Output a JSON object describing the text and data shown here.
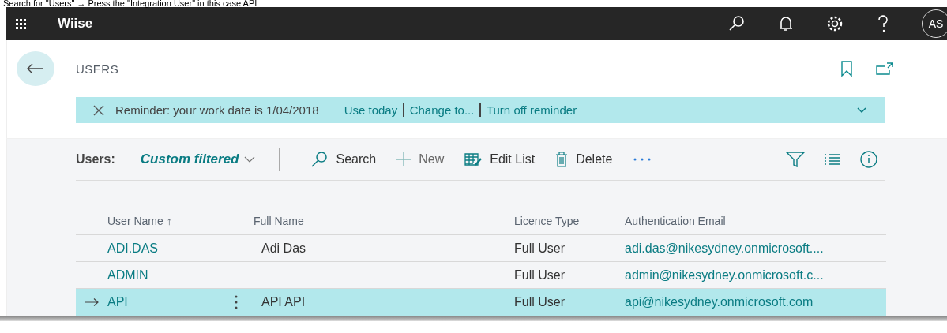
{
  "caption": "Search for \"Users\" → Press the \"Integration User\" in this case API",
  "topbar": {
    "app_name": "Wiise",
    "avatar": "AS"
  },
  "page": {
    "title": "USERS"
  },
  "reminder": {
    "message": "Reminder: your work date is 1/04/2018",
    "actions": [
      "Use today",
      "Change to...",
      "Turn off reminder"
    ]
  },
  "action_bar": {
    "view_label": "Users:",
    "filter": "Custom filtered",
    "actions": [
      "Search",
      "New",
      "Edit List",
      "Delete"
    ]
  },
  "table": {
    "columns": [
      "User Name ↑",
      "Full Name",
      "Licence Type",
      "Authentication Email"
    ],
    "rows": [
      {
        "user_name": "ADI.DAS",
        "full_name": "Adi Das",
        "licence_type": "Full User",
        "email": "adi.das@nikesydney.onmicrosoft....",
        "selected": false
      },
      {
        "user_name": "ADMIN",
        "full_name": "",
        "licence_type": "Full User",
        "email": "admin@nikesydney.onmicrosoft.c...",
        "selected": false
      },
      {
        "user_name": "API",
        "full_name": "API API",
        "licence_type": "Full User",
        "email": "api@nikesydney.onmicrosoft.com",
        "selected": true
      }
    ]
  }
}
